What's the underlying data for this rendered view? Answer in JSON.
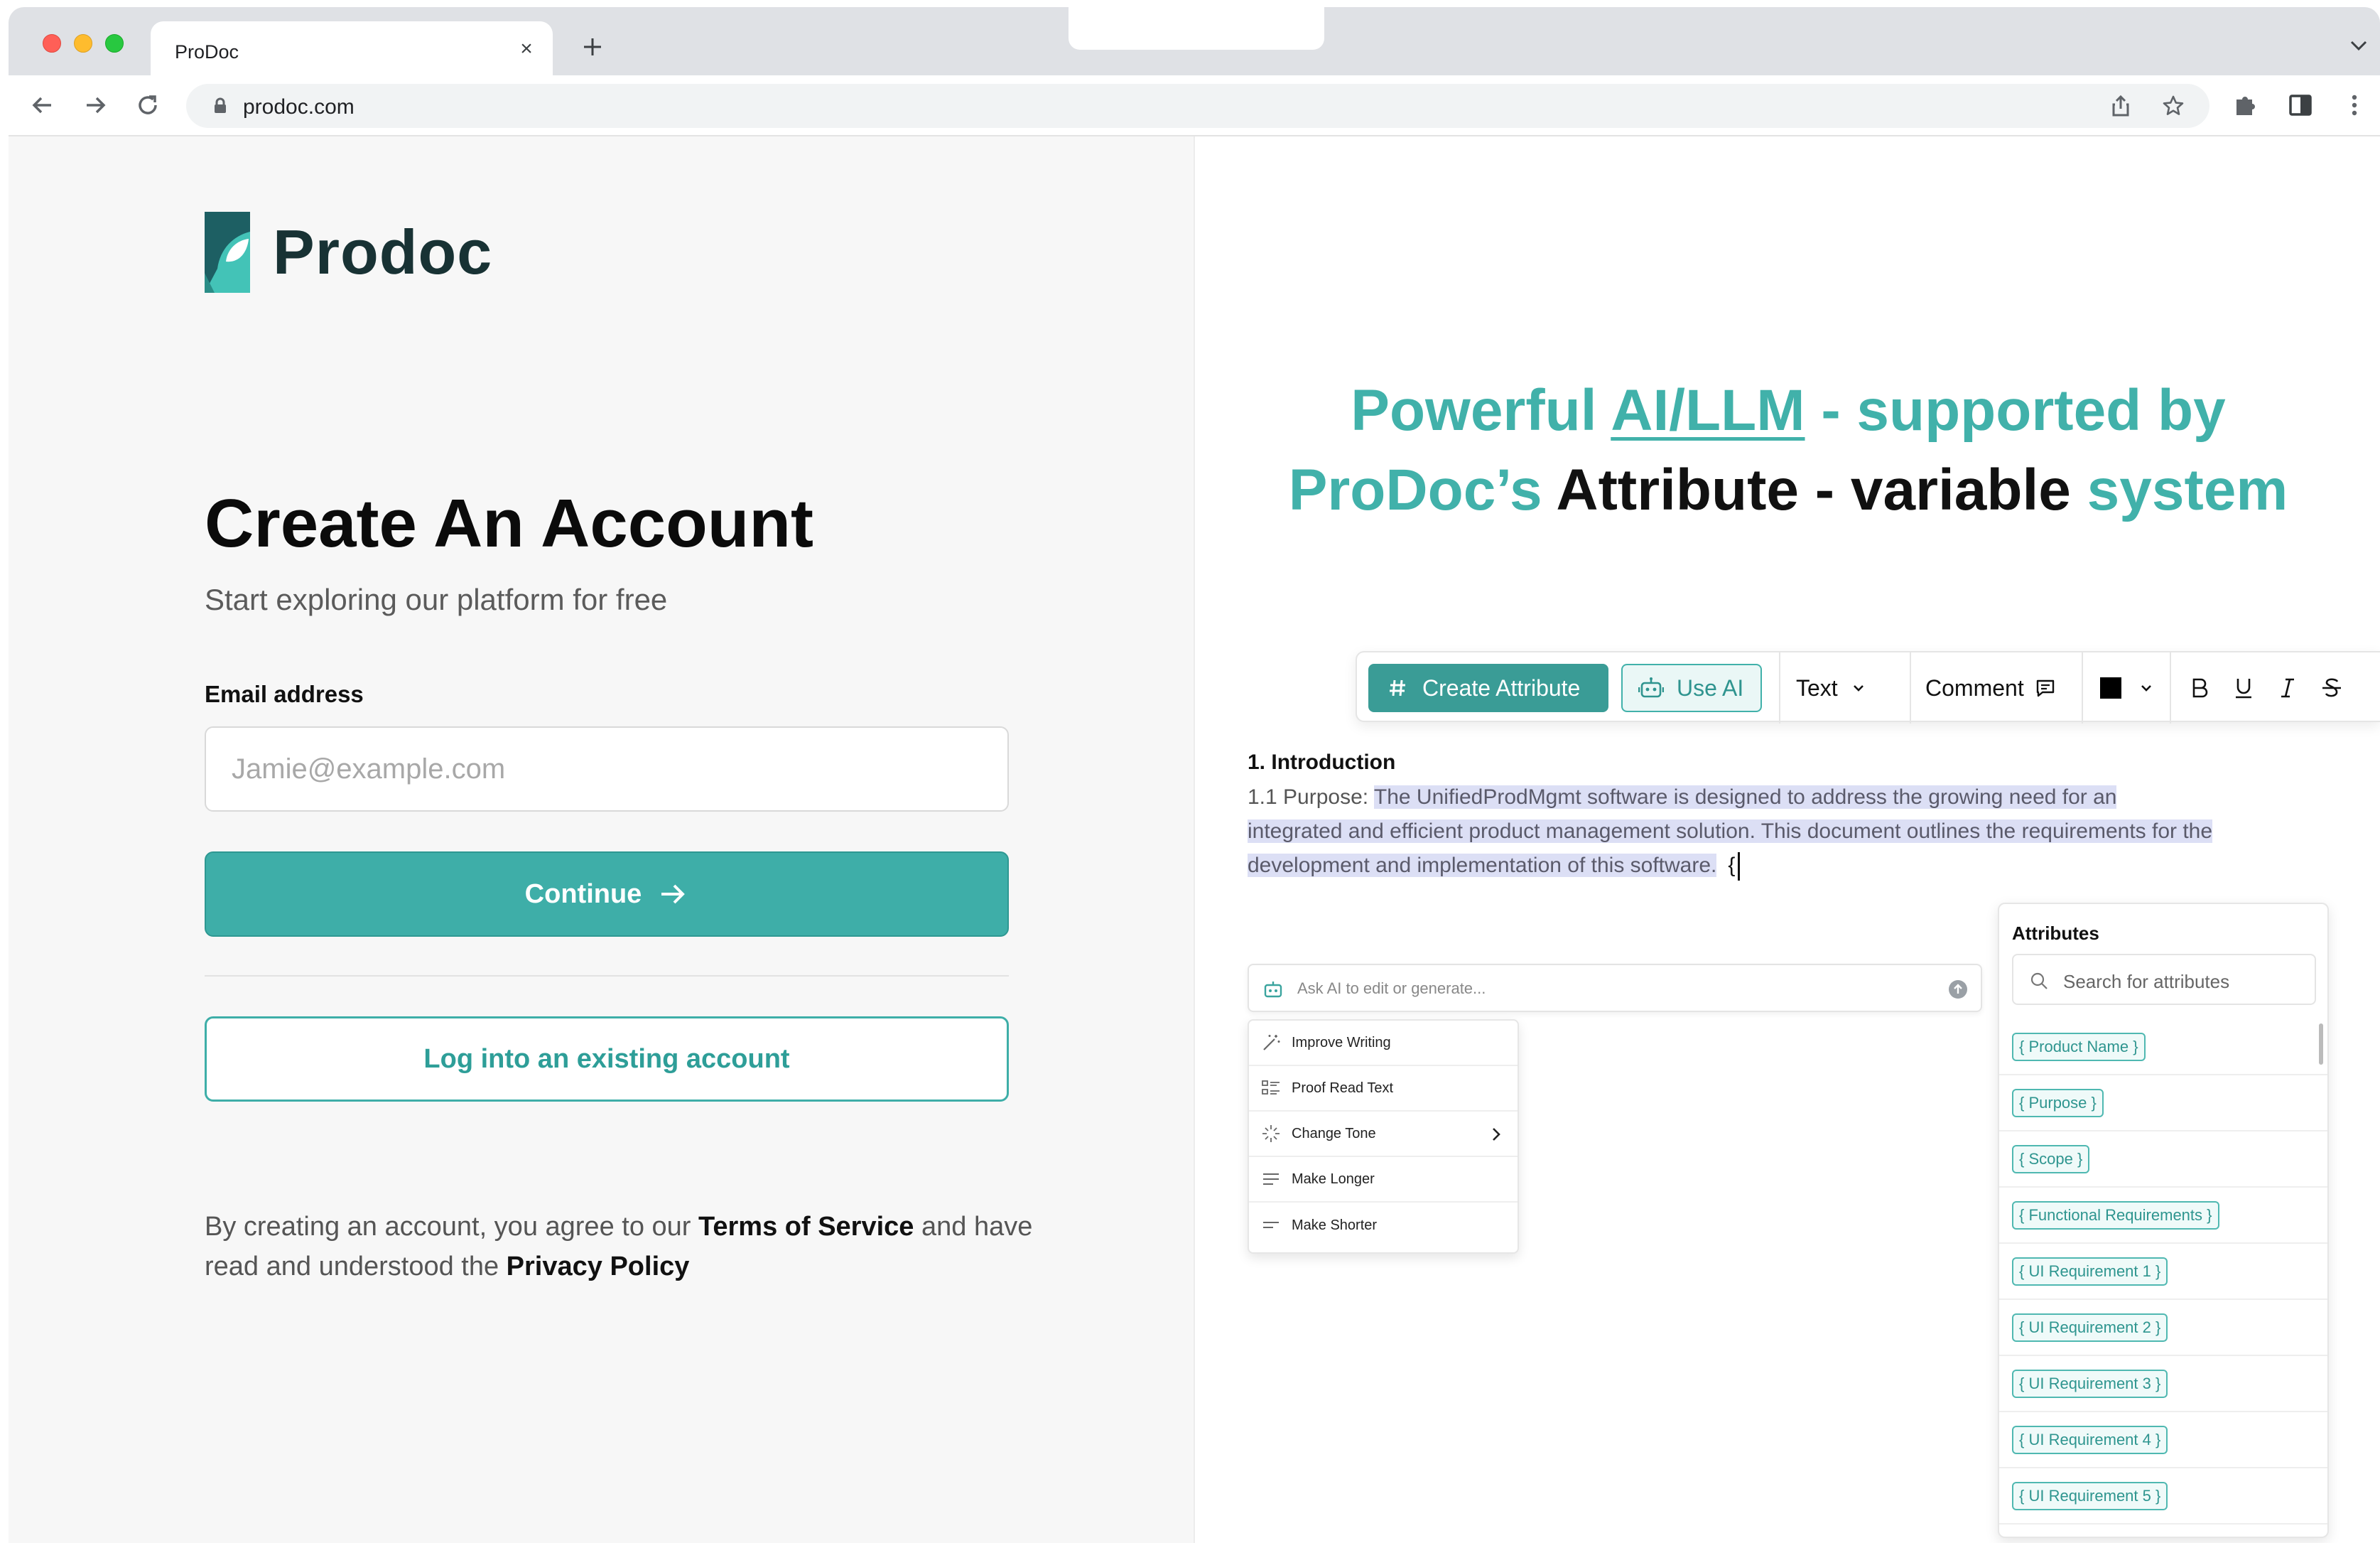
{
  "browser": {
    "tab_title": "ProDoc",
    "tab_close": "×",
    "url": "prodoc.com"
  },
  "left": {
    "logo_text": "Prodoc",
    "title": "Create An Account",
    "subtitle": "Start exploring our platform for free",
    "email_label": "Email address",
    "email_placeholder": "Jamie@example.com",
    "email_value": "",
    "continue_label": "Continue",
    "login_label": "Log into an existing account",
    "legal": {
      "part1": "By creating an account, you agree to our ",
      "terms": "Terms of Service",
      "part2": " and have read and understood the ",
      "privacy": "Privacy Policy"
    }
  },
  "right": {
    "headline": {
      "part1": "Powerful ",
      "link": "AI/LLM",
      "part2": " - supported by",
      "part3": "ProDoc’s ",
      "part4": "Attribute - variable ",
      "part5": "system"
    },
    "toolbar": {
      "create_attribute": "Create Attribute",
      "use_ai": "Use AI",
      "text": "Text",
      "comment": "Comment",
      "color": "#000000"
    },
    "doc": {
      "heading": "1. Introduction",
      "prefix": "1.1 Purpose: ",
      "highlighted": "The UnifiedProdMgmt software is designed to address the growing need for an integrated and efficient product management solution. This document outlines the requirements for the development and implementation of this software.",
      "brace": "{"
    },
    "ai": {
      "placeholder": "Ask AI to edit or generate...",
      "menu": [
        "Improve Writing",
        "Proof Read Text",
        "Change Tone",
        "Make Longer",
        "Make Shorter"
      ]
    },
    "attributes": {
      "title": "Attributes",
      "search_placeholder": "Search for attributes",
      "items": [
        "{ Product Name }",
        "{ Purpose }",
        "{ Scope }",
        "{ Functional Requirements }",
        "{ UI Requirement 1 }",
        "{ UI Requirement 2 }",
        "{ UI Requirement 3 }",
        "{ UI Requirement 4 }",
        "{ UI Requirement 5 }"
      ]
    }
  },
  "colors": {
    "accent": "#3eaea8",
    "headline_teal": "#41b1aa",
    "highlight": "#dcdff5"
  }
}
